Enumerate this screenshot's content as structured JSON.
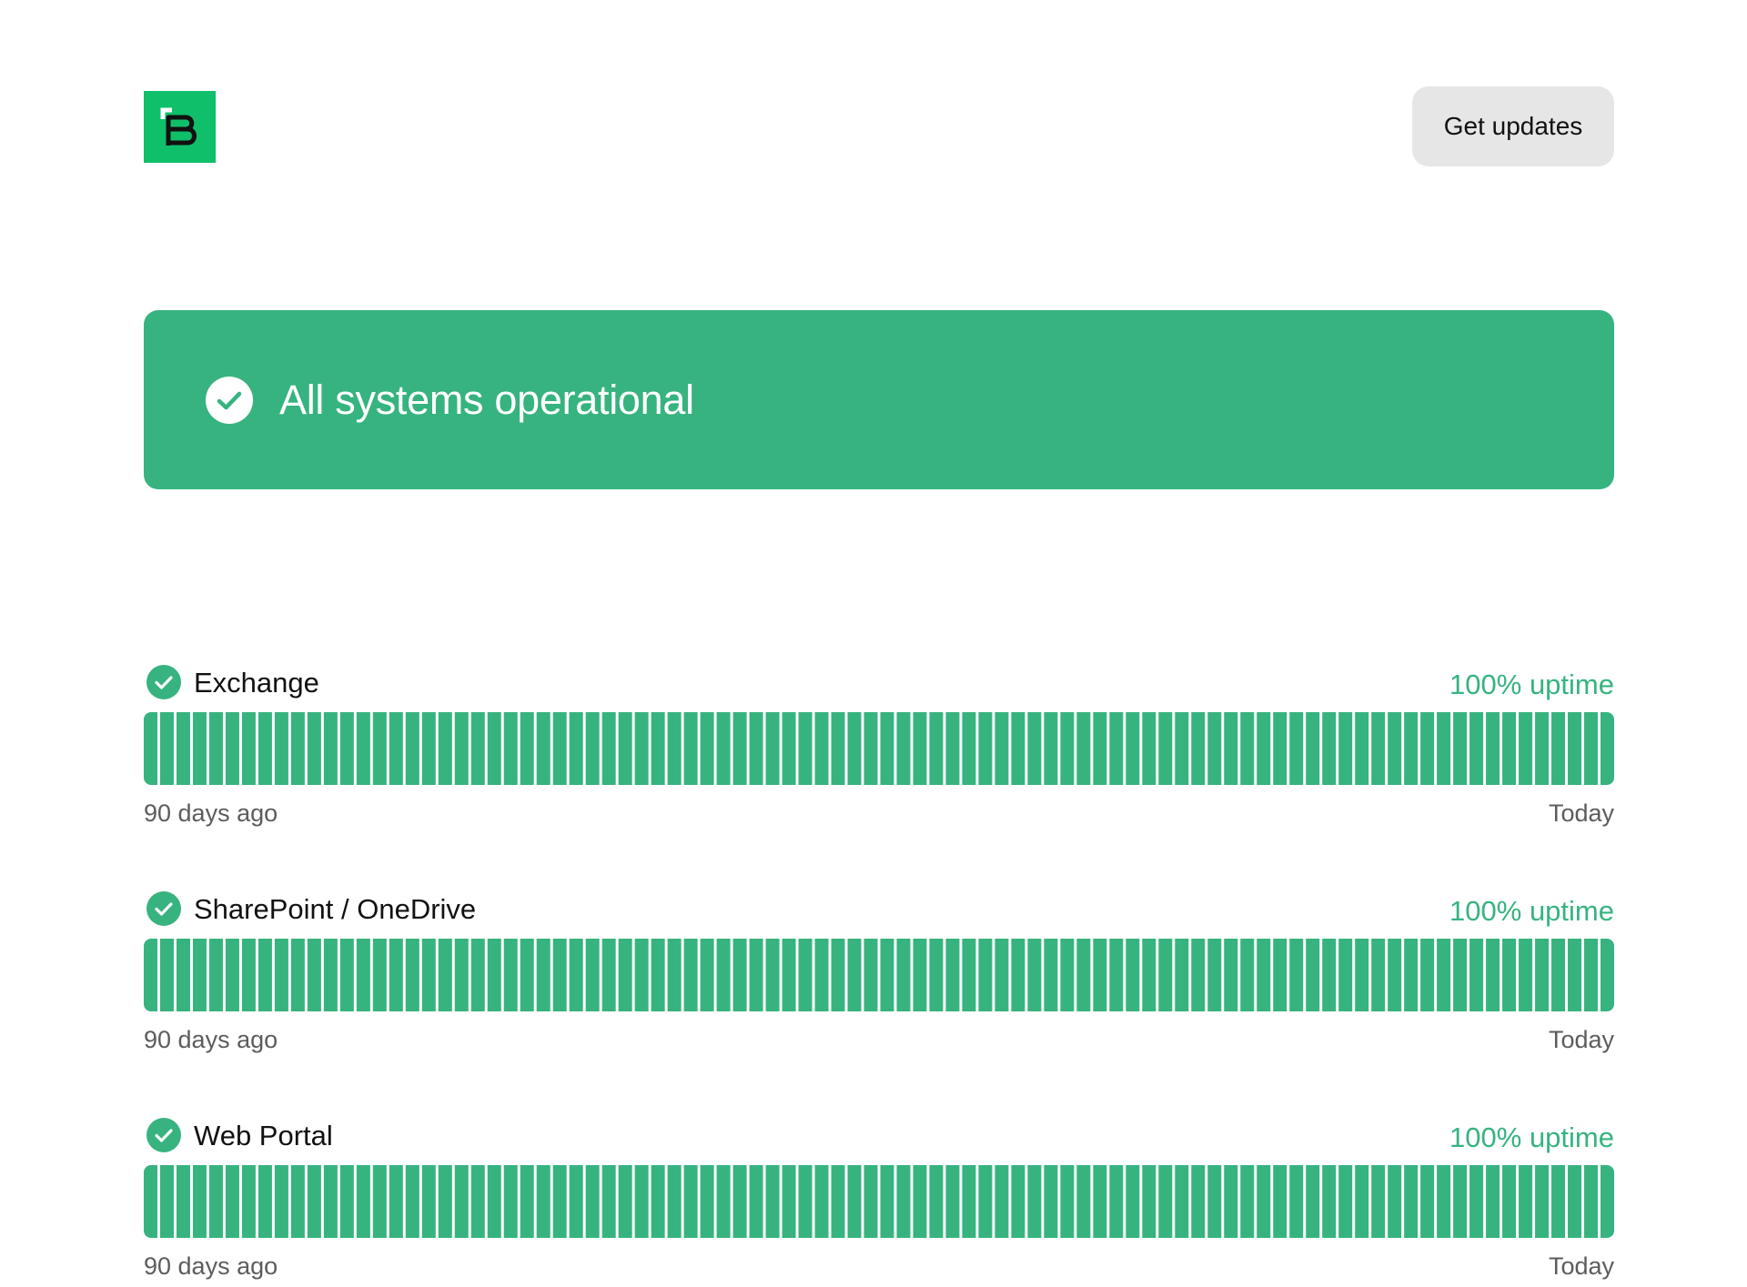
{
  "header": {
    "get_updates_label": "Get updates"
  },
  "banner": {
    "title": "All systems operational",
    "icon": "check-circle-icon"
  },
  "colors": {
    "brand": "#0fbf6a",
    "operational": "#37b37f",
    "muted_text": "#5c5c5c",
    "button_bg": "#e6e6e6"
  },
  "components": [
    {
      "name": "Exchange",
      "uptime": "100% uptime",
      "range_start": "90 days ago",
      "range_end": "Today",
      "days": 90,
      "status": "operational"
    },
    {
      "name": "SharePoint / OneDrive",
      "uptime": "100% uptime",
      "range_start": "90 days ago",
      "range_end": "Today",
      "days": 90,
      "status": "operational"
    },
    {
      "name": "Web Portal",
      "uptime": "100% uptime",
      "range_start": "90 days ago",
      "range_end": "Today",
      "days": 90,
      "status": "operational"
    }
  ]
}
